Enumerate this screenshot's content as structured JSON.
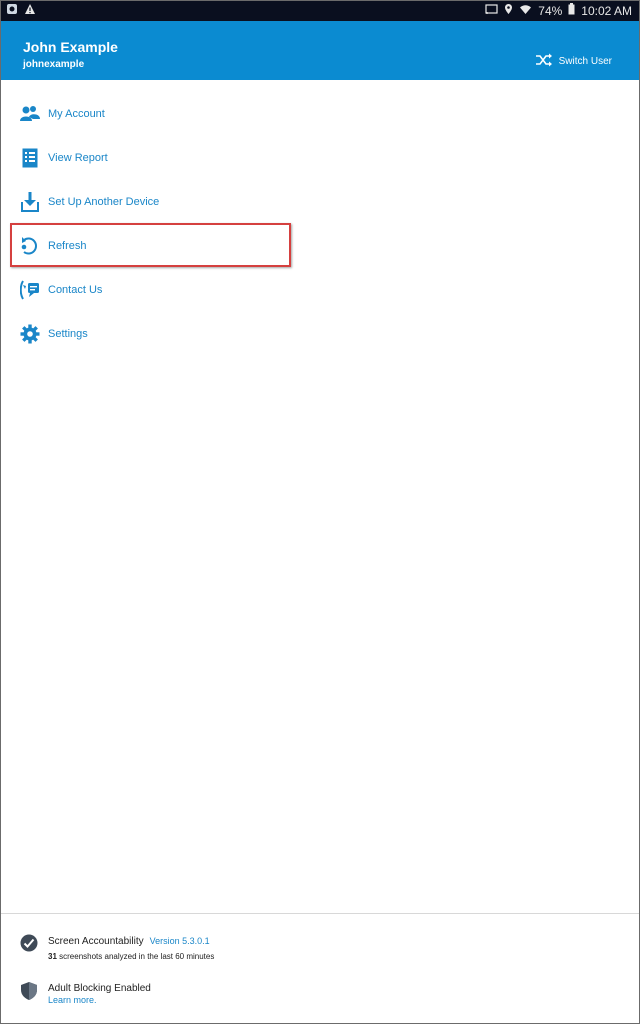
{
  "status_bar": {
    "battery": "74%",
    "time": "10:02 AM",
    "icons": [
      "notification-app-icon",
      "warning-icon",
      "cast-icon",
      "location-icon",
      "wifi-icon",
      "battery-icon"
    ]
  },
  "header": {
    "name": "John Example",
    "username": "johnexample",
    "switch_user_label": "Switch User"
  },
  "menu": {
    "items": [
      {
        "label": "My Account",
        "icon": "account-icon"
      },
      {
        "label": "View Report",
        "icon": "report-icon"
      },
      {
        "label": "Set Up Another Device",
        "icon": "download-icon"
      },
      {
        "label": "Refresh",
        "icon": "refresh-icon"
      },
      {
        "label": "Contact Us",
        "icon": "contact-icon"
      },
      {
        "label": "Settings",
        "icon": "gear-icon"
      }
    ]
  },
  "footer": {
    "accountability_title": "Screen Accountability",
    "version": "Version 5.3.0.1",
    "screenshot_count": "31",
    "screenshot_text": "screenshots analyzed in the last 60 minutes",
    "blocking_title": "Adult Blocking Enabled",
    "learn_more": "Learn more."
  },
  "colors": {
    "header_bg": "#0b8bd1",
    "accent": "#1a86c8",
    "highlight": "#d5403f",
    "status_bar_bg": "#0a0f1f"
  }
}
